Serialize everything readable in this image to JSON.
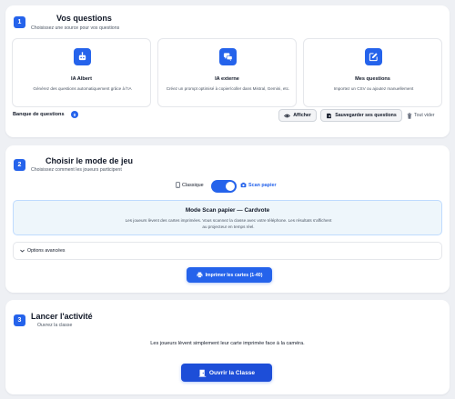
{
  "section1": {
    "step": "1",
    "title": "Vos questions",
    "subtitle": "Choisissez une source pour vos questions",
    "sources": [
      {
        "icon": "robot-icon",
        "title": "IA Albert",
        "desc": "Générez des questions automatiquement grâce à l'IA"
      },
      {
        "icon": "chat-bubbles-icon",
        "title": "IA externe",
        "desc": "Créez un prompt optimisé à copier/coller dans Mistral, Gemini, etc."
      },
      {
        "icon": "edit-icon",
        "title": "Mes questions",
        "desc": "Importez un CSV ou ajoutez manuellement"
      }
    ],
    "bank_label": "Banque de questions",
    "bank_count": "0",
    "show_label": "Afficher",
    "save_label": "Sauvegarder ses questions",
    "clear_label": "Tout vider"
  },
  "section2": {
    "step": "2",
    "title": "Choisir le mode de jeu",
    "subtitle": "Choisissez comment les joueurs participent",
    "mode_classic": "Classique",
    "mode_scan": "Scan papier",
    "toggle_on": true,
    "panel_title": "Mode Scan papier — Cardvote",
    "panel_desc": "Les joueurs lèvent des cartes imprimées. Vous scannez la classe avec votre téléphone. Les résultats s'affichent au projecteur en temps réel.",
    "advanced_label": "Options avancées",
    "print_label": "Imprimer les cartes (1-40)"
  },
  "section3": {
    "step": "3",
    "title": "Lancer l'activité",
    "subtitle": "Ouvrez la classe",
    "desc": "Les joueurs lèvent simplement leur carte imprimée face à la caméra.",
    "open_label": "Ouvrir la Classe"
  },
  "colors": {
    "accent": "#2563eb",
    "accent_dark": "#1d4ed8",
    "page_bg": "#eef0f4",
    "panel_bg": "#eef6fb"
  }
}
